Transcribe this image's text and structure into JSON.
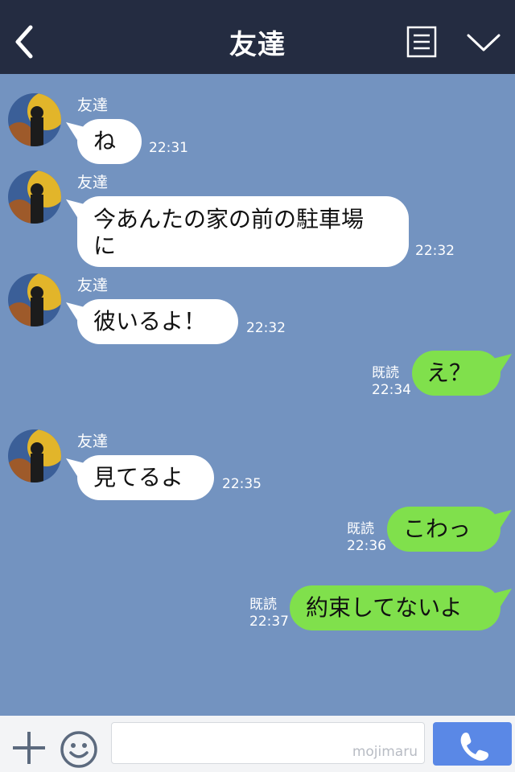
{
  "header": {
    "title": "友達",
    "back_icon": "chevron-left-icon",
    "menu_icon": "menu-list-icon",
    "collapse_icon": "chevron-down-icon"
  },
  "messages": [
    {
      "sender": "友達",
      "text": "ね",
      "time": "22:31"
    },
    {
      "sender": "友達",
      "text_line1": "今あんたの家の前の駐車場",
      "text_line2": "に",
      "time": "22:32"
    },
    {
      "sender": "友達",
      "text": "彼いるよ！",
      "time": "22:32"
    },
    {
      "text": "え？",
      "read": "既読",
      "time": "22:34"
    },
    {
      "sender": "友達",
      "text": "見てるよ",
      "time": "22:35"
    },
    {
      "text": "こわっ",
      "read": "既読",
      "time": "22:36"
    },
    {
      "text": "約束してないよ",
      "read": "既読",
      "time": "22:37"
    }
  ],
  "footer": {
    "add_icon": "plus-icon",
    "emoji_icon": "smiley-icon",
    "input_value": "",
    "watermark": "mojimaru",
    "call_icon": "phone-icon"
  },
  "colors": {
    "header_bg": "#242c41",
    "chat_bg": "#7393c0",
    "incoming_bubble": "#ffffff",
    "outgoing_bubble": "#80e04c",
    "call_button": "#5a88e6"
  }
}
